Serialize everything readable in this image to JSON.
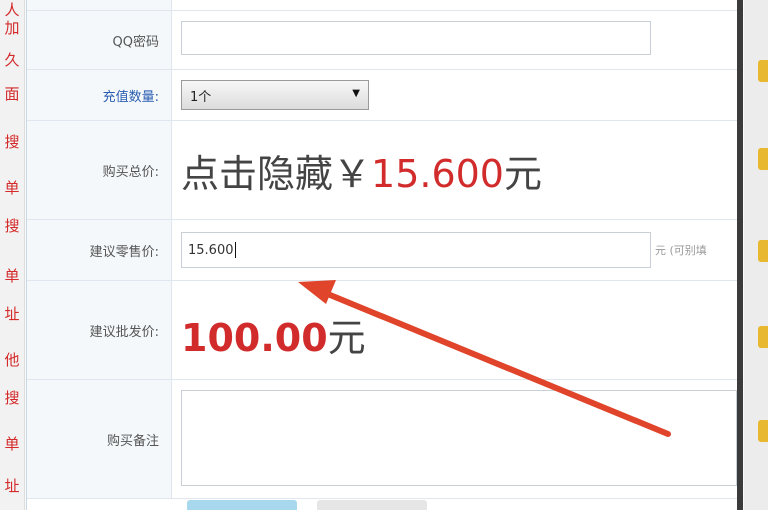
{
  "form": {
    "qq_label": "QQ密码",
    "qq_value": "",
    "quantity_label": "充值数量:",
    "quantity_selected": "1个",
    "price_label": "购买总价:",
    "price_hide_prefix": "点击隐藏￥",
    "price_value": "15.600",
    "price_unit": "元",
    "suggest_label": "建议零售价:",
    "suggest_value": "15.600",
    "suggest_note": "元 (可别填",
    "profit_label": "建议批发价:",
    "profit_value": "100.00",
    "profit_unit": "元",
    "remark_label": "购买备注",
    "remark_value": ""
  },
  "background": {
    "left_chars": [
      "人",
      "加",
      "久",
      "面",
      "搜",
      "单",
      "搜",
      "单",
      "址",
      "他",
      "搜",
      "单",
      "址"
    ]
  },
  "annotation": {
    "arrow_color": "#e0442a"
  }
}
